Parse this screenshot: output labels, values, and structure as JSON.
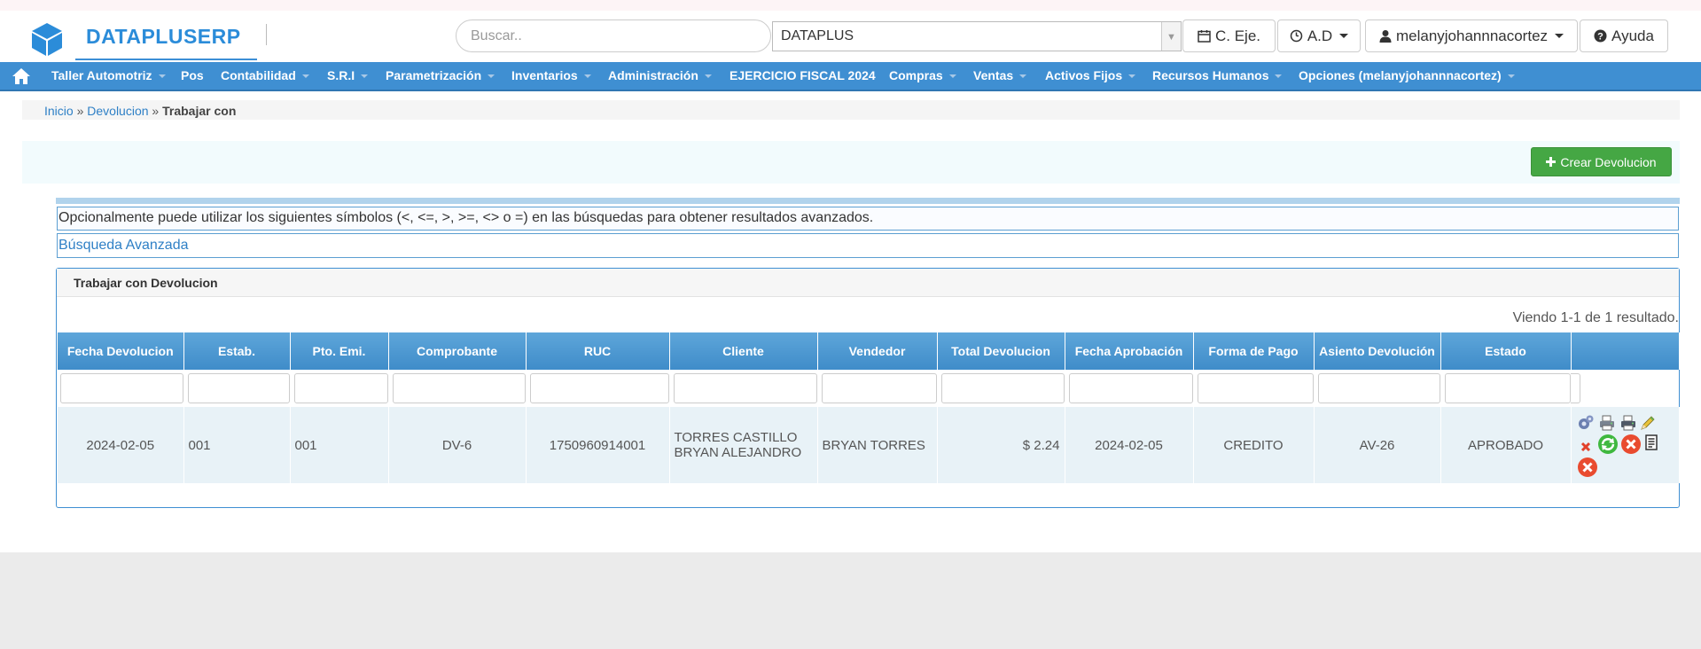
{
  "header": {
    "brand": "DATAPLUSERP",
    "logo_icon": "cube-icon",
    "search_placeholder": "Buscar..",
    "company_select": "DATAPLUS",
    "buttons": {
      "fiscal_year": "C. Eje.",
      "admin": "A.D",
      "user": "melanyjohannnacortez",
      "help": "Ayuda"
    }
  },
  "nav": {
    "items": [
      {
        "label": "Taller Automotriz"
      },
      {
        "label": "Pos"
      },
      {
        "label": "Contabilidad"
      },
      {
        "label": "S.R.I"
      },
      {
        "label": "Parametrización"
      },
      {
        "label": "Inventarios"
      },
      {
        "label": "Administración"
      },
      {
        "label": "EJERCICIO FISCAL 2024"
      },
      {
        "label": "Compras"
      },
      {
        "label": "Ventas"
      },
      {
        "label": "Activos Fijos"
      },
      {
        "label": "Recursos Humanos"
      },
      {
        "label": "Opciones (melanyjohannnacortez)"
      }
    ]
  },
  "breadcrumb": {
    "home": "Inicio",
    "sep1": "»",
    "section": "Devolucion",
    "sep2": "»",
    "current": "Trabajar con"
  },
  "actions": {
    "create_label": "Crear Devolucion"
  },
  "info": {
    "hint": "Opcionalmente puede utilizar los siguientes símbolos (<, <=, >, >=, <> o =) en las búsquedas para obtener resultados avanzados.",
    "advanced_search": "Búsqueda Avanzada"
  },
  "panel": {
    "title": "Trabajar con Devolucion",
    "summary": "Viendo 1-1 de 1 resultado."
  },
  "table": {
    "headers": [
      "Fecha Devolucion",
      "Estab.",
      "Pto. Emi.",
      "Comprobante",
      "RUC",
      "Cliente",
      "Vendedor",
      "Total Devolucion",
      "Fecha Aprobación",
      "Forma de Pago",
      "Asiento Devolución",
      "Estado",
      ""
    ],
    "rows": [
      {
        "fecha": "2024-02-05",
        "estab": "001",
        "pto_emi": "001",
        "comprobante": "DV-6",
        "ruc": "1750960914001",
        "cliente": "TORRES CASTILLO BRYAN ALEJANDRO",
        "vendedor": "BRYAN TORRES",
        "total": "$ 2.24",
        "fecha_aprobacion": "2024-02-05",
        "forma_pago": "CREDITO",
        "asiento": "AV-26",
        "estado": "APROBADO"
      }
    ],
    "row_action_icons": [
      "settings-icon",
      "print-icon",
      "print-alt-icon",
      "edit-icon",
      "delete-small-icon",
      "refresh-icon",
      "cancel-icon",
      "document-icon",
      "cancel-alt-icon"
    ]
  },
  "colors": {
    "brand": "#2b8cd9",
    "navbar": "#3f8fd2",
    "create_button": "#45a744",
    "table_header": "#4a97d0",
    "row_bg": "#e8f2f7"
  }
}
